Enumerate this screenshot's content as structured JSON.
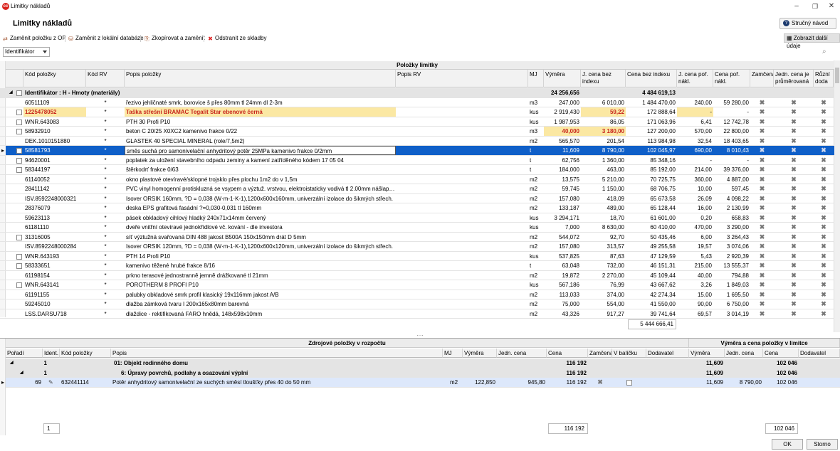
{
  "window": {
    "title": "Limitky nákladů",
    "app_icon": "app-logo-icon"
  },
  "page_title": "Limitky nákladů",
  "help_button": "Stručný návod",
  "toolbar": {
    "items": [
      {
        "label": "Zaměnit položku z OP",
        "icon": "swap-icon"
      },
      {
        "label": "Zaměnit z lokální databáze",
        "icon": "database-swap-icon"
      },
      {
        "label": "Zkopírovat a zaměnit",
        "icon": "copy-icon"
      },
      {
        "label": "Odstranit ze skladby",
        "icon": "delete-icon"
      }
    ],
    "more_label": "Zobrazit další údaje"
  },
  "filter": {
    "combo_value": "Identifikátor"
  },
  "grid": {
    "title": "Položky limitky",
    "columns": [
      "Kód položky",
      "Kód RV",
      "Popis položky",
      "Popis RV",
      "MJ",
      "Výměra",
      "J. cena bez indexu",
      "Cena bez indexu",
      "J. cena poř. nákl.",
      "Cena poř. nákl.",
      "Zamčená",
      "Jedn. cena je průměrovaná",
      "Různí doda"
    ],
    "group": {
      "label": "Identifikátor : H - Hmoty (materiály)",
      "vymera": "24 256,656",
      "cena": "4 484 619,13"
    },
    "rows": [
      {
        "kod": "60511109",
        "rv": "*",
        "popis": "řezivo jehličnaté smrk, borovice š přes 80mm tl 24mm dl 2-3m",
        "mj": "m3",
        "vym": "247,000",
        "jc": "6 010,00",
        "c": "1 484 470,00",
        "jpn": "240,00",
        "cpn": "59 280,00",
        "chk": false
      },
      {
        "kod": "1225478052",
        "rv": "*",
        "popis": "Taška střešní BRAMAC Tegalit Star ebenové černá",
        "mj": "kus",
        "vym": "2 919,430",
        "jc": "59,22",
        "c": "172 888,64",
        "jpn": "-",
        "cpn": "-",
        "chk": true,
        "red": true
      },
      {
        "kod": "WNR.643083",
        "rv": "*",
        "popis": "PTH 30 Profi P10",
        "mj": "kus",
        "vym": "1 987,953",
        "jc": "86,05",
        "c": "171 063,96",
        "jpn": "6,41",
        "cpn": "12 742,78",
        "chk": true
      },
      {
        "kod": "58932910",
        "rv": "*",
        "popis": "beton C 20/25 X0XC2 kamenivo frakce 0/22",
        "mj": "m3",
        "vym": "40,000",
        "jc": "3 180,00",
        "c": "127 200,00",
        "jpn": "570,00",
        "cpn": "22 800,00",
        "chk": true,
        "hlnum": true
      },
      {
        "kod": "DEK.1010151880",
        "rv": "*",
        "popis": "GLASTEK 40 SPECIAL MINERAL (role/7,5m2)",
        "mj": "m2",
        "vym": "565,570",
        "jc": "201,54",
        "c": "113 984,98",
        "jpn": "32,54",
        "cpn": "18 403,65",
        "chk": false
      },
      {
        "kod": "58581793",
        "rv": "*",
        "popis": "směs suchá pro samonivelační anhydritový potěr 25MPa kamenivo frakce 0/2mm",
        "mj": "t",
        "vym": "11,609",
        "jc": "8 790,00",
        "c": "102 045,97",
        "jpn": "690,00",
        "cpn": "8 010,43",
        "chk": true,
        "sel": true
      },
      {
        "kod": "94620001",
        "rv": "*",
        "popis": "poplatek za uložení stavebního odpadu zeminy a kamení zatříděného kódem 17 05 04",
        "mj": "t",
        "vym": "62,756",
        "jc": "1 360,00",
        "c": "85 348,16",
        "jpn": "-",
        "cpn": "-",
        "chk": true
      },
      {
        "kod": "58344197",
        "rv": "*",
        "popis": "štěrkodrť frakce 0/63",
        "mj": "t",
        "vym": "184,000",
        "jc": "463,00",
        "c": "85 192,00",
        "jpn": "214,00",
        "cpn": "39 376,00",
        "chk": true
      },
      {
        "kod": "61140052",
        "rv": "*",
        "popis": "okno plastové otevíravé/sklopné trojsklo přes plochu 1m2 do v 1,5m",
        "mj": "m2",
        "vym": "13,575",
        "jc": "5 210,00",
        "c": "70 725,75",
        "jpn": "360,00",
        "cpn": "4 887,00",
        "chk": false
      },
      {
        "kod": "28411142",
        "rv": "*",
        "popis": "PVC vinyl homogenní protiskluzná se vsypem a výztuž. vrstvou, elektroistaticky vodivá tl 2.00mm nášlap…",
        "mj": "m2",
        "vym": "59,745",
        "jc": "1 150,00",
        "c": "68 706,75",
        "jpn": "10,00",
        "cpn": "597,45",
        "chk": false
      },
      {
        "kod": "ISV.8592248000321",
        "rv": "*",
        "popis": "Isover ORSIK 160mm, ?D = 0,038 (W·m-1·K-1),1200x600x160mm, univerzální izolace do šikmých střech.",
        "mj": "m2",
        "vym": "157,080",
        "jc": "418,09",
        "c": "65 673,58",
        "jpn": "26,09",
        "cpn": "4 098,22",
        "chk": false
      },
      {
        "kod": "28376079",
        "rv": "*",
        "popis": "deska EPS grafitová fasádní ?=0,030-0,031 tl 160mm",
        "mj": "m2",
        "vym": "133,187",
        "jc": "489,00",
        "c": "65 128,44",
        "jpn": "16,00",
        "cpn": "2 130,99",
        "chk": false
      },
      {
        "kod": "59623113",
        "rv": "*",
        "popis": "pásek obkladový cihlový hladký 240x71x14mm červený",
        "mj": "kus",
        "vym": "3 294,171",
        "jc": "18,70",
        "c": "61 601,00",
        "jpn": "0,20",
        "cpn": "658,83",
        "chk": false
      },
      {
        "kod": "61181110",
        "rv": "*",
        "popis": "dveře vnitřní otevíravé jednokřídlové vč. kování - dle investora",
        "mj": "kus",
        "vym": "7,000",
        "jc": "8 630,00",
        "c": "60 410,00",
        "jpn": "470,00",
        "cpn": "3 290,00",
        "chk": false
      },
      {
        "kod": "31316005",
        "rv": "*",
        "popis": "síť výztužná svařovaná DIN 488 jakost B500A 150x150mm drát D 5mm",
        "mj": "m2",
        "vym": "544,072",
        "jc": "92,70",
        "c": "50 435,46",
        "jpn": "6,00",
        "cpn": "3 264,43",
        "chk": true
      },
      {
        "kod": "ISV.8592248000284",
        "rv": "*",
        "popis": "Isover ORSIK 120mm, ?D = 0,038 (W·m-1·K-1),1200x600x120mm, univerzální izolace do šikmých střech.",
        "mj": "m2",
        "vym": "157,080",
        "jc": "313,57",
        "c": "49 255,58",
        "jpn": "19,57",
        "cpn": "3 074,06",
        "chk": false
      },
      {
        "kod": "WNR.643193",
        "rv": "*",
        "popis": "PTH 14 Profi P10",
        "mj": "kus",
        "vym": "537,825",
        "jc": "87,63",
        "c": "47 129,59",
        "jpn": "5,43",
        "cpn": "2 920,39",
        "chk": true
      },
      {
        "kod": "58333651",
        "rv": "*",
        "popis": "kamenivo těžené hrubé frakce 8/16",
        "mj": "t",
        "vym": "63,048",
        "jc": "732,00",
        "c": "46 151,31",
        "jpn": "215,00",
        "cpn": "13 555,37",
        "chk": true
      },
      {
        "kod": "61198154",
        "rv": "*",
        "popis": "prkno terasové jednostranně jemně drážkované tl 21mm",
        "mj": "m2",
        "vym": "19,872",
        "jc": "2 270,00",
        "c": "45 109,44",
        "jpn": "40,00",
        "cpn": "794,88",
        "chk": false
      },
      {
        "kod": "WNR.643141",
        "rv": "*",
        "popis": "POROTHERM 8 PROFI  P10",
        "mj": "kus",
        "vym": "567,186",
        "jc": "76,99",
        "c": "43 667,62",
        "jpn": "3,26",
        "cpn": "1 849,03",
        "chk": true
      },
      {
        "kod": "61191155",
        "rv": "*",
        "popis": "palubky obkladové smrk profil klasický 19x116mm jakost A/B",
        "mj": "m2",
        "vym": "113,033",
        "jc": "374,00",
        "c": "42 274,34",
        "jpn": "15,00",
        "cpn": "1 695,50",
        "chk": false
      },
      {
        "kod": "59245010",
        "rv": "*",
        "popis": "dlažba zámková tvaru I 200x165x80mm barevná",
        "mj": "m2",
        "vym": "75,000",
        "jc": "554,00",
        "c": "41 550,00",
        "jpn": "90,00",
        "cpn": "6 750,00",
        "chk": false
      },
      {
        "kod": "LSS.DARSU718",
        "rv": "*",
        "popis": "dlaždice - rektifikovaná FARO hnědá, 148x598x10mm",
        "mj": "m2",
        "vym": "43,326",
        "jc": "917,27",
        "c": "39 741,64",
        "jpn": "69,57",
        "cpn": "3 014,19",
        "chk": false
      }
    ],
    "sum": "5 444 666,41"
  },
  "bottom": {
    "title_left": "Zdrojové položky v rozpočtu",
    "title_right": "Výměra a cena položky v limitce",
    "columns": [
      "Pořadí",
      "Ident.",
      "Kód položky",
      "Popis",
      "MJ",
      "Výměra",
      "Jedn. cena",
      "Cena",
      "Zamčená",
      "V balíčku",
      "Dodavatel",
      "Výměra",
      "Jedn. cena",
      "Cena",
      "Dodavatel"
    ],
    "groups": [
      {
        "poradi": "1",
        "popis": "01: Objekt rodinného domu",
        "cena": "116 192",
        "vym2": "11,609",
        "cena2": "102 046"
      },
      {
        "poradi": "1",
        "popis": "6: Úpravy povrchů, podlahy a osazování výplní",
        "cena": "116 192",
        "vym2": "11,609",
        "cena2": "102 046"
      }
    ],
    "row": {
      "poradi": "69",
      "kod": "632441114",
      "popis": "Potěr anhydritový samonivelační ze suchých směsí tloušťky přes 40 do 50 mm",
      "mj": "m2",
      "vym": "122,850",
      "jc": "945,80",
      "cena": "116 192",
      "vym2": "11,609",
      "jc2": "8 790,00",
      "cena2": "102 046"
    },
    "footer": {
      "count": "1",
      "cena": "116 192",
      "cena2": "102 046"
    }
  },
  "buttons": {
    "ok": "OK",
    "cancel": "Storno"
  }
}
